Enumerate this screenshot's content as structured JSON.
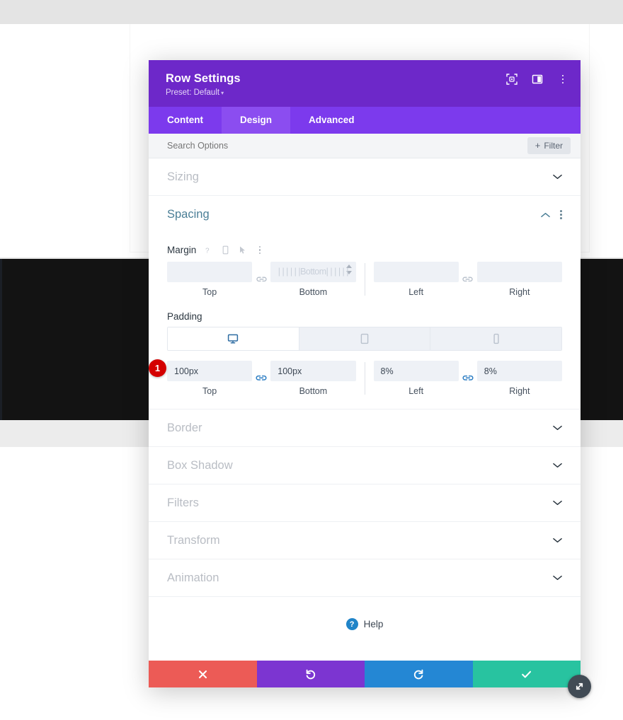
{
  "modal": {
    "title": "Row Settings",
    "preset_label": "Preset: Default",
    "header_icons": [
      {
        "name": "focus-target-icon",
        "label": "Focus"
      },
      {
        "name": "layout-panel-icon",
        "label": "Panel Layout"
      },
      {
        "name": "more-vertical-icon",
        "label": "More Options"
      }
    ],
    "tabs": [
      {
        "label": "Content",
        "active": false
      },
      {
        "label": "Design",
        "active": true
      },
      {
        "label": "Advanced",
        "active": false
      }
    ],
    "search": {
      "placeholder": "Search Options",
      "value": ""
    },
    "filter_button": {
      "plus": "+",
      "label": "Filter"
    },
    "sections": [
      {
        "label": "Sizing",
        "open": false
      },
      {
        "label": "Spacing",
        "open": true
      },
      {
        "label": "Border",
        "open": false
      },
      {
        "label": "Box Shadow",
        "open": false
      },
      {
        "label": "Filters",
        "open": false
      },
      {
        "label": "Transform",
        "open": false
      },
      {
        "label": "Animation",
        "open": false
      }
    ],
    "spacing": {
      "margin": {
        "label": "Margin",
        "icons": [
          "help-icon",
          "responsive-icon",
          "hover-cursor-icon",
          "more-vertical-icon"
        ],
        "link_glyph": "c/o",
        "artifact_text": "| | | | | |Bottom| | | | | |",
        "fields": [
          {
            "caption": "Top",
            "value": "",
            "placeholder": ""
          },
          {
            "caption": "Bottom",
            "value": "",
            "placeholder": ""
          },
          {
            "caption": "Left",
            "value": "",
            "placeholder": ""
          },
          {
            "caption": "Right",
            "value": "",
            "placeholder": ""
          }
        ]
      },
      "padding": {
        "label": "Padding",
        "devices": [
          {
            "name": "desktop",
            "active": true
          },
          {
            "name": "tablet",
            "active": false
          },
          {
            "name": "phone",
            "active": false
          }
        ],
        "badge": "1",
        "fields": [
          {
            "caption": "Top",
            "value": "100px"
          },
          {
            "caption": "Bottom",
            "value": "100px"
          },
          {
            "caption": "Left",
            "value": "8%"
          },
          {
            "caption": "Right",
            "value": "8%"
          }
        ]
      }
    },
    "help": {
      "icon_glyph": "?",
      "label": "Help"
    },
    "footer_buttons": [
      {
        "name": "close-button",
        "icon": "x-icon",
        "color": "#ec5b56"
      },
      {
        "name": "undo-button",
        "icon": "undo-icon",
        "color": "#7c35d1"
      },
      {
        "name": "redo-button",
        "icon": "redo-icon",
        "color": "#2487d4"
      },
      {
        "name": "save-button",
        "icon": "check-icon",
        "color": "#28c3a0"
      }
    ]
  },
  "colors": {
    "header_purple": "#6d28c9",
    "tab_purple": "#7c3aed",
    "tab_active_purple": "#8b4df0",
    "accent_teal": "#4a7e96",
    "badge_red": "#d40000",
    "device_active_blue": "#2d6ca2",
    "link_blue": "#2f7fc4"
  }
}
